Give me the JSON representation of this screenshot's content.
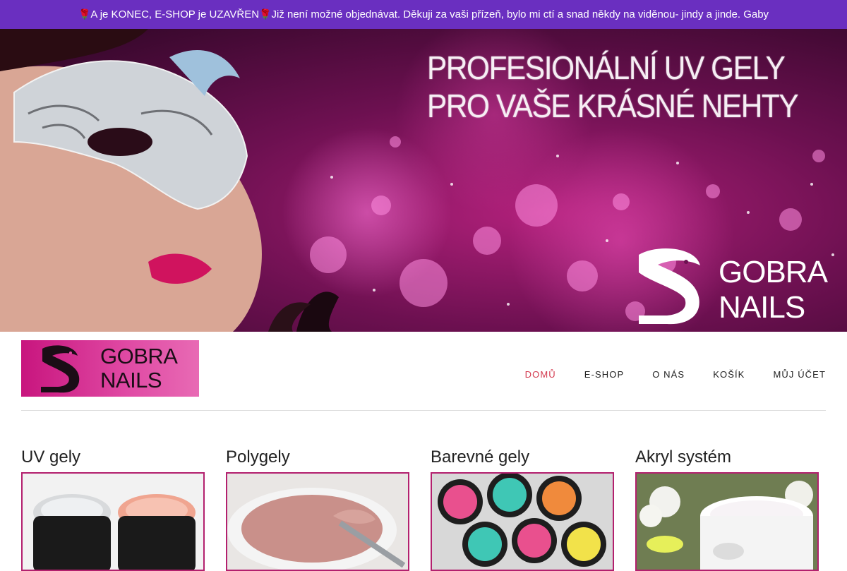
{
  "notice": {
    "rose_left": "🌹",
    "text_a": "A je KONEC, E-SHOP je UZAVŘEN",
    "rose_right": "🌹",
    "text_b": " Již není možné objednávat. Děkuji za vaši přízeň, bylo mi ctí a snad někdy na viděnou- jindy a jinde. Gaby",
    "color": "#6a2fc0"
  },
  "hero": {
    "headline_line1": "PROFESIONÁLNÍ UV GELY",
    "headline_line2": "PRO VAŠE KRÁSNÉ NEHTY",
    "brand_line1": "GOBRA",
    "brand_line2": "NAILS"
  },
  "logo": {
    "line1": "GOBRA",
    "line2": "NAILS",
    "color": "#c8157e"
  },
  "nav": {
    "items": [
      {
        "label": "DOMŮ",
        "active": true
      },
      {
        "label": "E-SHOP",
        "active": false
      },
      {
        "label": "O NÁS",
        "active": false
      },
      {
        "label": "KOŠÍK",
        "active": false
      },
      {
        "label": "MŮJ ÚČET",
        "active": false
      }
    ],
    "active_color": "#d3394e"
  },
  "categories": [
    {
      "title": "UV gely"
    },
    {
      "title": "Polygely"
    },
    {
      "title": "Barevné gely"
    },
    {
      "title": "Akryl systém"
    }
  ]
}
